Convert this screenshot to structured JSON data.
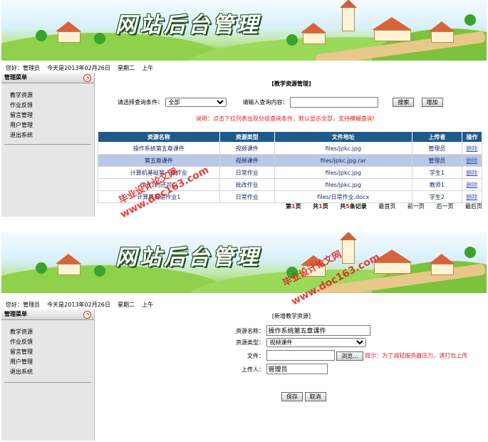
{
  "banner_title": "网站后台管理",
  "info": {
    "greeting": "您好：管理员",
    "date": "今天是2013年02月26日",
    "weekday": "星期二",
    "period": "上午"
  },
  "sidebar": {
    "title": "管理菜单",
    "items": [
      {
        "label": "教学资源"
      },
      {
        "label": "作业反馈"
      },
      {
        "label": "留言管理"
      },
      {
        "label": "用户管理"
      },
      {
        "label": "退出系统"
      }
    ]
  },
  "list_page": {
    "title": "[教学资源管理]",
    "query_label": "请选择查询条件：",
    "query_select": "全部",
    "input_label": "请输入查询内容：",
    "search_button": "搜索",
    "add_button": "增加",
    "hint": "说明：点击下拉列表出现分组查询条件，默认显示全部，支持模糊查询!",
    "columns": [
      "资源名称",
      "资源类型",
      "文件地址",
      "上传者",
      "操作"
    ],
    "rows": [
      {
        "name": "操作系统第五章课件",
        "type": "视频课件",
        "path": "files/jpkc.jpg",
        "uploader": "管理员",
        "op": "删除"
      },
      {
        "name": "第五章课件",
        "type": "视频课件",
        "path": "files/jpkc.jpg.rar",
        "uploader": "管理员",
        "op": "删除"
      },
      {
        "name": "计算机基础第一章作业",
        "type": "日常作业",
        "path": "files/jpkc.jpg",
        "uploader": "学生1",
        "op": "删除"
      },
      {
        "name": "作业1的还可以",
        "type": "批改作业",
        "path": "files/jpkc.jpg",
        "uploader": "教师1",
        "op": "删除"
      },
      {
        "name": "计算机英语作业1",
        "type": "日常作业",
        "path": "files/日常作业.docx",
        "uploader": "学生2",
        "op": "删除"
      }
    ],
    "pager": {
      "p1_pre": "第",
      "p1_num": "1",
      "p1_post": "页",
      "p2_pre": "共",
      "p2_num": "1",
      "p2_post": "页",
      "p3_pre": "共",
      "p3_num": "5",
      "p3_post": "条记录",
      "first": "最首页",
      "prev": "前一页",
      "next": "后一页",
      "last": "最后页"
    }
  },
  "form_page": {
    "title": "[新增教学资源]",
    "name_label": "资源名称：",
    "name_value": "操作系统第五章课件",
    "type_label": "资源类型：",
    "type_value": "视频课件",
    "file_label": "文件：",
    "browse_button": "浏览...",
    "tip": "提示：为了减轻服务器压力，请打包上传",
    "uploader_label": "上传人：",
    "uploader_value": "管理员",
    "save_button": "保存",
    "cancel_button": "取消"
  },
  "watermark": {
    "line1": "毕业设计论文网",
    "line2": "www.doc163.com"
  }
}
